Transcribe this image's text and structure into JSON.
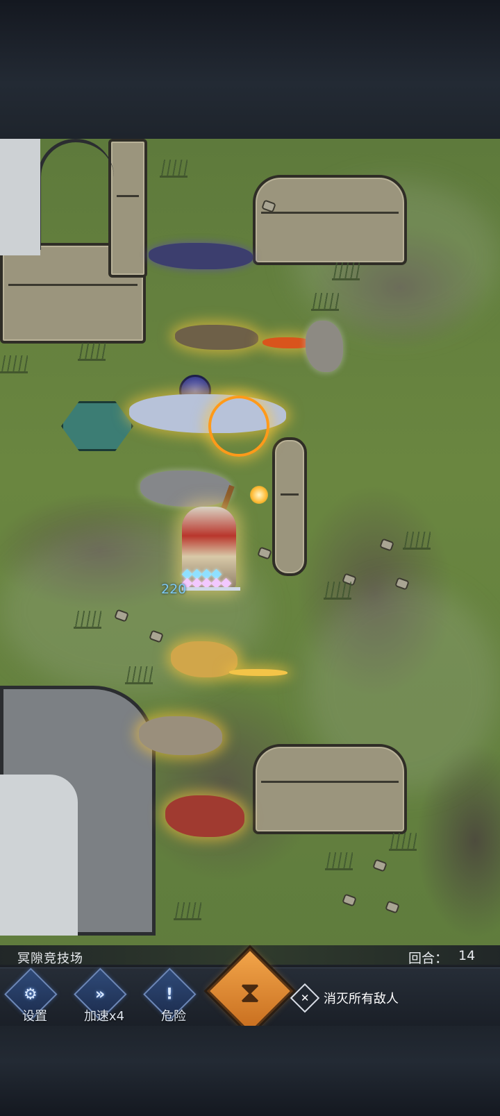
{
  "battle": {
    "arena_name": "冥隙竞技场",
    "round_label": "回合：",
    "round_value": "14",
    "hero_hp": "220"
  },
  "controls": [
    {
      "label": "设置",
      "icon": "gear-icon",
      "glyph": "⚙"
    },
    {
      "label": "加速x4",
      "icon": "fast-forward-icon",
      "glyph": "»"
    },
    {
      "label": "危险",
      "icon": "exclamation-icon",
      "glyph": "!"
    }
  ],
  "hourglass": {
    "icon": "hourglass-icon",
    "glyph": "⧗"
  },
  "objective": {
    "icon": "crossed-swords-icon",
    "glyph": "✕",
    "text": "消灭所有敌人"
  },
  "colors": {
    "hp_text": "#7ec8f2",
    "control_button": "#2f4a78",
    "hourglass_button": "#f2a54a",
    "grass": "#6a8640"
  }
}
